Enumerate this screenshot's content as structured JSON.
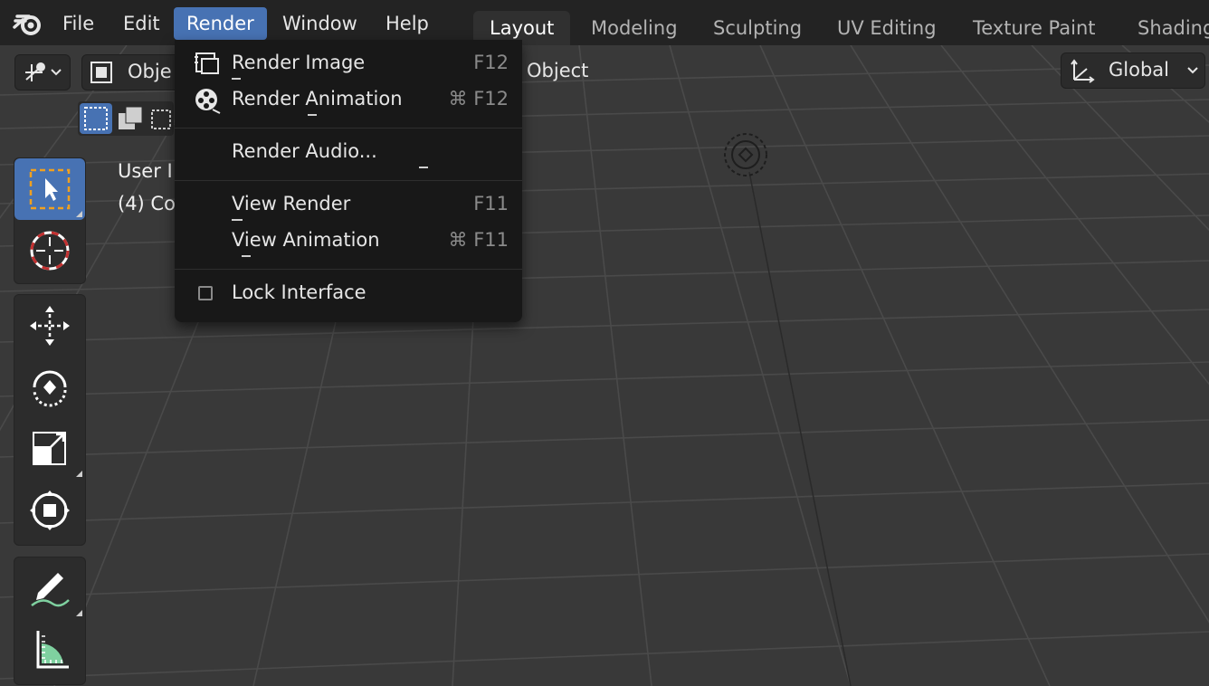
{
  "topbar": {
    "menus": [
      "File",
      "Edit",
      "Render",
      "Window",
      "Help"
    ],
    "tabs": [
      "Layout",
      "Modeling",
      "Sculpting",
      "UV Editing",
      "Texture Paint",
      "Shading"
    ]
  },
  "viewport_header": {
    "mode_label": "Obje",
    "object_menu": "Object",
    "orientation": "Global"
  },
  "overlay": {
    "view_name": "User I",
    "collection": "(4) Co"
  },
  "render_menu": {
    "items": [
      {
        "label": "Render Image",
        "shortcut": "F12",
        "icon": "render-image-icon"
      },
      {
        "label": "Render Animation",
        "shortcut": "⌘ F12",
        "icon": "render-animation-icon"
      },
      {
        "label": "Render Audio...",
        "shortcut": ""
      },
      {
        "label": "View Render",
        "shortcut": "F11"
      },
      {
        "label": "View Animation",
        "shortcut": "⌘ F11"
      },
      {
        "label": "Lock Interface",
        "shortcut": "",
        "icon": "checkbox-icon"
      }
    ]
  },
  "colors": {
    "accent": "#4772b3",
    "background": "#393939",
    "menu_bg": "#181818"
  }
}
